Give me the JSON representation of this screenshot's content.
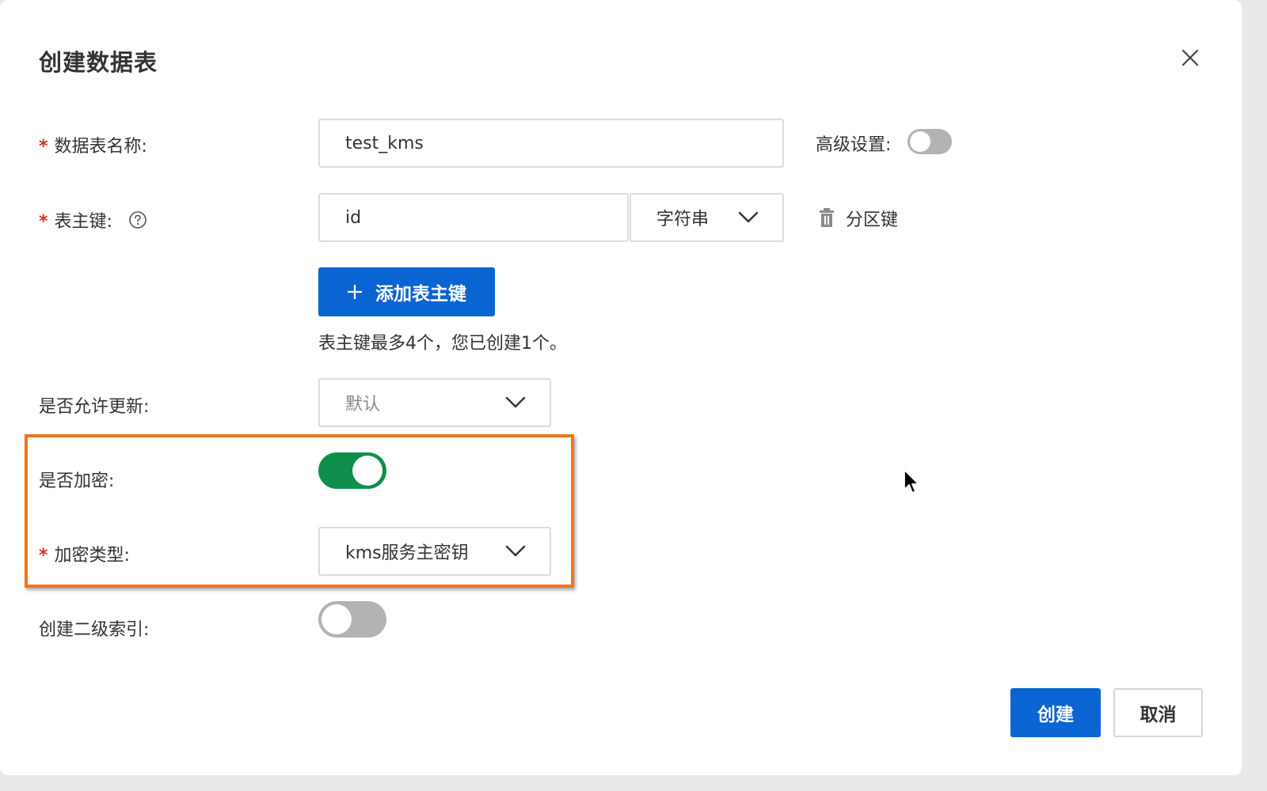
{
  "dialog": {
    "title": "创建数据表"
  },
  "form": {
    "table_name": {
      "required_mark": "*",
      "label": "数据表名称:",
      "value": "test_kms"
    },
    "advanced": {
      "label": "高级设置:",
      "enabled": false
    },
    "primary_key": {
      "required_mark": "*",
      "label": "表主键:",
      "name_value": "id",
      "type_value": "字符串",
      "partition_key_label": "分区键"
    },
    "add_primary_key": {
      "label": "添加表主键",
      "hint": "表主键最多4个，您已创建1个。"
    },
    "allow_update": {
      "label": "是否允许更新:",
      "value": "默认"
    },
    "encryption": {
      "label": "是否加密:",
      "enabled": true
    },
    "encryption_type": {
      "required_mark": "*",
      "label": "加密类型:",
      "value": "kms服务主密钥"
    },
    "secondary_index": {
      "label": "创建二级索引:",
      "enabled": false
    }
  },
  "footer": {
    "create_label": "创建",
    "cancel_label": "取消"
  },
  "colors": {
    "primary": "#0a64d2",
    "toggle_on": "#0d8f4b",
    "toggle_off": "#b3b3b3",
    "highlight": "#f5741a",
    "required": "#d93026"
  }
}
